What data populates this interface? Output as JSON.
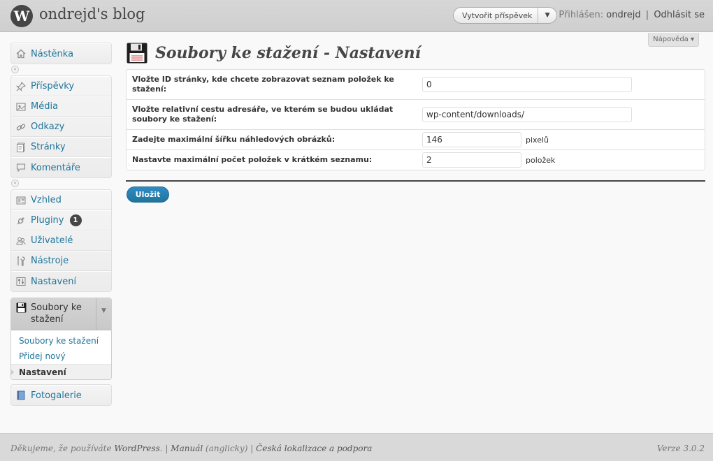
{
  "header": {
    "logo_glyph": "W",
    "site_title": "ondrejd's blog",
    "favorites_label": "Vytvořit příspěvek",
    "favorites_arrow": "▼",
    "logged_in_label": "Přihlášen:",
    "username": "ondrejd",
    "separator": "|",
    "logout_label": "Odhlásit se",
    "help_label": "Nápověda ▾"
  },
  "sidebar": {
    "dashboard": [
      {
        "label": "Nástěnka",
        "icon": "home-icon"
      }
    ],
    "content": [
      {
        "label": "Příspěvky",
        "icon": "pin-icon"
      },
      {
        "label": "Média",
        "icon": "media-icon"
      },
      {
        "label": "Odkazy",
        "icon": "link-icon"
      },
      {
        "label": "Stránky",
        "icon": "pages-icon"
      },
      {
        "label": "Komentáře",
        "icon": "comment-icon"
      }
    ],
    "admin": [
      {
        "label": "Vzhled",
        "icon": "appearance-icon"
      },
      {
        "label": "Pluginy",
        "icon": "plugin-icon",
        "badge": "1"
      },
      {
        "label": "Uživatelé",
        "icon": "users-icon"
      },
      {
        "label": "Nástroje",
        "icon": "tools-icon"
      },
      {
        "label": "Nastavení",
        "icon": "settings-icon"
      }
    ],
    "active_menu": {
      "label": "Soubory ke stažení",
      "icon": "floppy-disk-icon",
      "submenu": [
        "Soubory ke stažení",
        "Přidej nový",
        "Nastavení"
      ],
      "current": "Nastavení"
    },
    "gallery": {
      "label": "Fotogalerie",
      "icon": "gallery-icon"
    },
    "collapse_glyph": "«"
  },
  "main": {
    "page_title": "Soubory ke stažení - Nastavení",
    "fields": [
      {
        "label": "Vložte ID stránky, kde chcete zobrazovat seznam položek ke stažení:",
        "value": "0",
        "unit": ""
      },
      {
        "label": "Vložte relativní cestu adresáře, ve kterém se budou ukládat soubory ke stažení:",
        "value": "wp-content/downloads/",
        "unit": ""
      },
      {
        "label": "Zadejte maximální šířku náhledových obrázků:",
        "value": "146",
        "unit": "pixelů"
      },
      {
        "label": "Nastavte maximální počet položek v krátkém seznamu:",
        "value": "2",
        "unit": "položek"
      }
    ],
    "save_label": "Uložit"
  },
  "footer": {
    "thanks_text": "Děkujeme, že používáte",
    "wordpress_link": "WordPress",
    "manual_link": "Manuál",
    "manual_note": "(anglicky)",
    "localization_link": "Česká lokalizace a podpora",
    "version": "Verze 3.0.2"
  },
  "colors": {
    "accent": "#21759b",
    "header_bg": "#d7d7d7",
    "footer_bg": "#d9d9d9",
    "badge": "#464646"
  }
}
